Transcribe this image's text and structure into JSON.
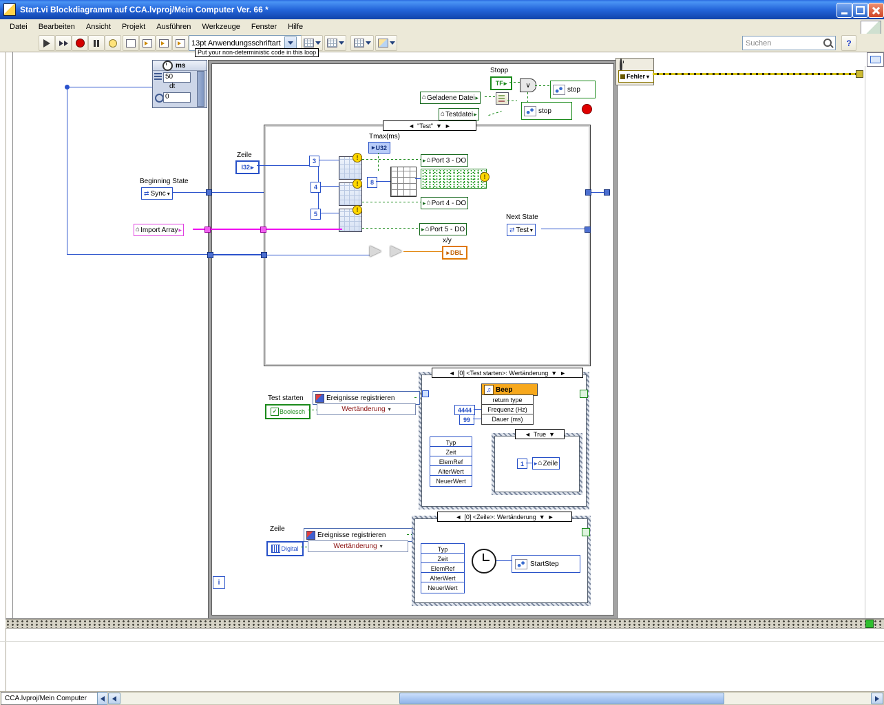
{
  "window": {
    "title": "Start.vi Blockdiagramm auf CCA.lvproj/Mein Computer Ver. 66 *"
  },
  "menu": {
    "items": [
      "Datei",
      "Bearbeiten",
      "Ansicht",
      "Projekt",
      "Ausführen",
      "Werkzeuge",
      "Fenster",
      "Hilfe"
    ]
  },
  "toolbar": {
    "font_label": "13pt Anwendungsschriftart",
    "search_placeholder": "Suchen"
  },
  "icons": {
    "house": "⌂",
    "play": "▸",
    "dropdown": "▾",
    "sel_left": "◄",
    "sel_right": "►",
    "sel_down": "▼",
    "or": "∨",
    "note": "♫",
    "warning": "!",
    "check": "✓",
    "enum_arrows": "⇄",
    "help": "?"
  },
  "diagram": {
    "comment": "Put your non-deterministic code in this loop",
    "wait": {
      "header": "ms",
      "value_top": "50",
      "dt": "dt",
      "value_bottom": "0"
    },
    "stopp": {
      "label": "Stopp",
      "terminal": "TF"
    },
    "stop_node1": "stop",
    "stop_node2": "stop",
    "geladene_datei": "Geladene Datei",
    "testdatei": "Testdatei",
    "fehler": "Fehler",
    "case_test": {
      "selector": "\"Test\"",
      "tmax_label": "Tmax(ms)",
      "tmax_type": "U32"
    },
    "zeile_in": {
      "label": "Zeile",
      "type": "I32"
    },
    "beginning_state": {
      "label": "Beginning State",
      "value": "Sync"
    },
    "constants": {
      "c3": "3",
      "c4": "4",
      "c5": "5",
      "c8": "8"
    },
    "ports": {
      "p3": "Port 3 - DO",
      "p4": "Port 4 - DO",
      "p5": "Port 5 - DO"
    },
    "import_array": "Import Array",
    "next_state": {
      "label": "Next State",
      "value": "Test"
    },
    "divide": {
      "label": "x/y",
      "type": "DBL"
    },
    "event1": {
      "header": "[0] <Test starten>: Wertänderung",
      "beep": {
        "title": "Beep",
        "return_type": "return type",
        "freq_label": "Frequenz (Hz)",
        "freq_value": "4444",
        "dauer_label": "Dauer (ms)",
        "dauer_value": "99"
      },
      "fields": [
        "Typ",
        "Zeit",
        "ElemRef",
        "AlterWert",
        "NeuerWert"
      ],
      "case_true": {
        "selector": "True",
        "const": "1",
        "local": "Zeile"
      }
    },
    "register1": {
      "label": "Test starten",
      "terminal": "Boolesch",
      "title": "Ereignisse registrieren",
      "event": "Wertänderung"
    },
    "event2": {
      "header": "[0] <Zeile>: Wertänderung",
      "fields": [
        "Typ",
        "Zeit",
        "ElemRef",
        "AlterWert",
        "NeuerWert"
      ],
      "invoke": "StartStep"
    },
    "register2": {
      "label": "Zeile",
      "terminal": "Digital",
      "title": "Ereignisse registrieren",
      "event": "Wertänderung"
    },
    "iteration": "i"
  },
  "statusbar": {
    "tab": "CCA.lvproj/Mein Computer"
  }
}
